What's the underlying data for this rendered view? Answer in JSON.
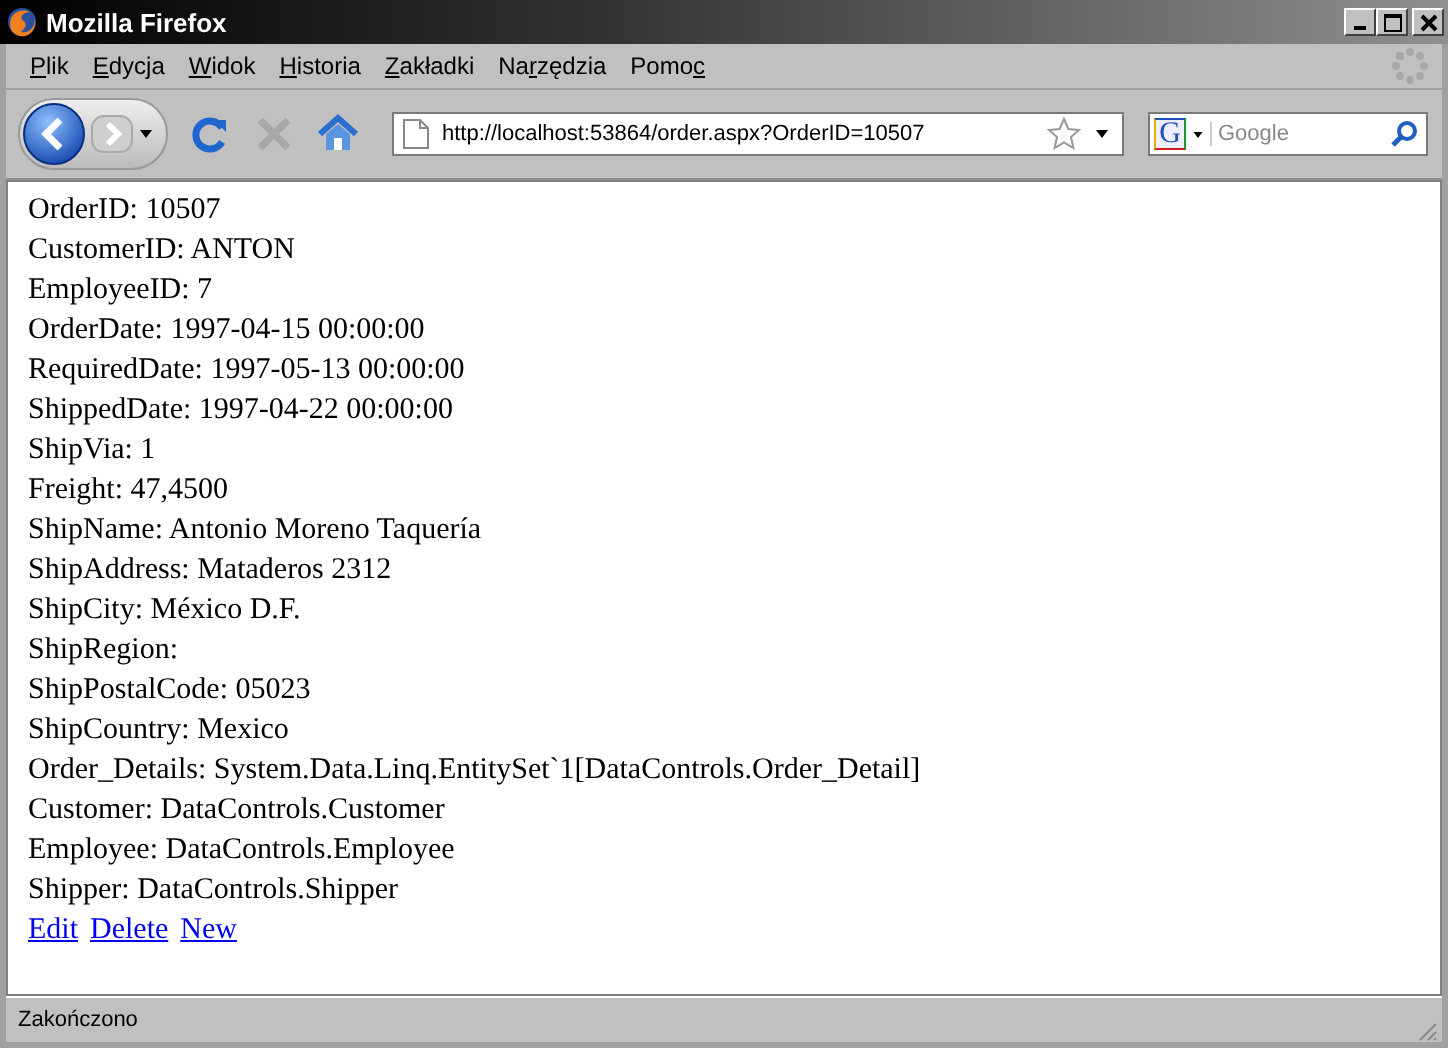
{
  "window": {
    "title": "Mozilla Firefox"
  },
  "menu": [
    {
      "key": "P",
      "post": "lik"
    },
    {
      "key": "E",
      "post": "dycja"
    },
    {
      "key": "W",
      "post": "idok"
    },
    {
      "key": "H",
      "post": "istoria"
    },
    {
      "key": "Z",
      "post": "akładki"
    },
    {
      "pre": "Na",
      "key": "r",
      "post": "zędzia"
    },
    {
      "pre": "Pomo",
      "key": "c"
    }
  ],
  "address": {
    "value": "http://localhost:53864/order.aspx?OrderID=10507"
  },
  "search": {
    "engine_letter": "G",
    "placeholder": "Google"
  },
  "lines": [
    "OrderID: 10507",
    "CustomerID: ANTON",
    "EmployeeID: 7",
    "OrderDate: 1997-04-15 00:00:00",
    "RequiredDate: 1997-05-13 00:00:00",
    "ShippedDate: 1997-04-22 00:00:00",
    "ShipVia: 1",
    "Freight: 47,4500",
    "ShipName: Antonio Moreno Taquería",
    "ShipAddress: Mataderos 2312",
    "ShipCity: México D.F.",
    "ShipRegion:",
    "ShipPostalCode: 05023",
    "ShipCountry: Mexico",
    "Order_Details: System.Data.Linq.EntitySet`1[DataControls.Order_Detail]",
    "Customer: DataControls.Customer",
    "Employee: DataControls.Employee",
    "Shipper: DataControls.Shipper"
  ],
  "links": [
    "Edit",
    "Delete",
    "New"
  ],
  "status_bar": {
    "text": "Zakończono"
  }
}
